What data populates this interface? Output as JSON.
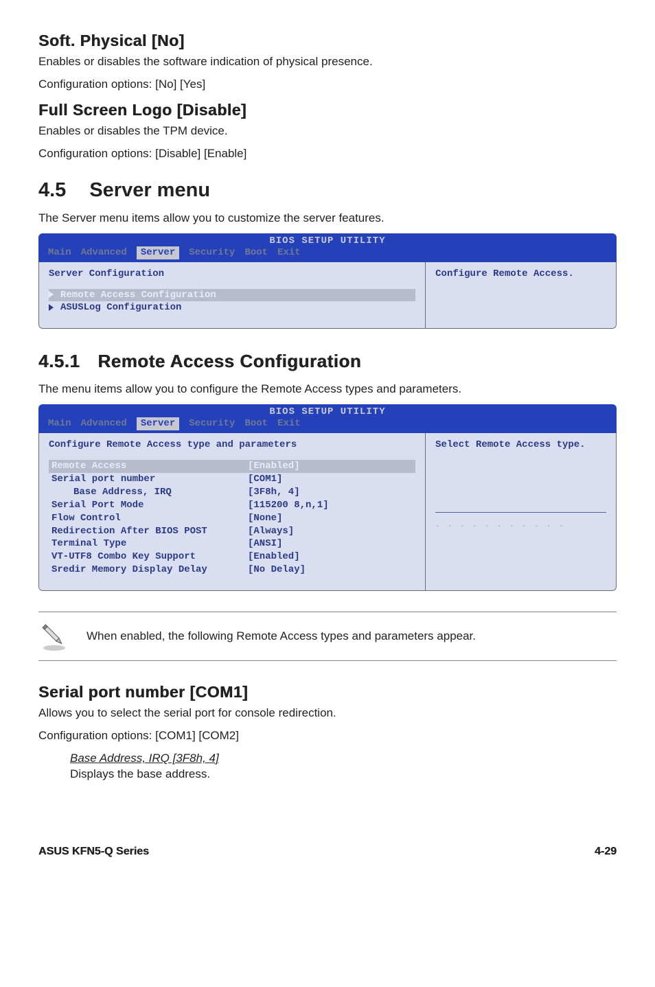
{
  "soft": {
    "heading": "Soft. Physical [No]",
    "line1": "Enables or disables the software indication of physical presence.",
    "line2": "Configuration options: [No] [Yes]"
  },
  "fsl": {
    "heading": "Full Screen Logo [Disable]",
    "line1": "Enables or disables the TPM device.",
    "line2": "Configuration options: [Disable] [Enable]"
  },
  "server_menu": {
    "num": "4.5",
    "title": "Server menu",
    "desc": "The Server menu items allow you to customize the server features."
  },
  "bios1": {
    "title": "BIOS SETUP UTILITY",
    "tabs": [
      "Main",
      "Advanced",
      "Server",
      "Security",
      "Boot",
      "Exit"
    ],
    "selected_tab": "Server",
    "section": "Server Configuration",
    "items": [
      "Remote Access Configuration",
      "ASUSLog Configuration"
    ],
    "help": "Configure Remote Access."
  },
  "remote": {
    "num": "4.5.1",
    "title": "Remote Access Configuration",
    "desc": "The menu items allow you to configure the Remote Access  types and parameters."
  },
  "bios2": {
    "title": "BIOS SETUP UTILITY",
    "tabs": [
      "Main",
      "Advanced",
      "Server",
      "Security",
      "Boot",
      "Exit"
    ],
    "selected_tab": "Server",
    "section": "Configure Remote Access type and parameters",
    "params": [
      {
        "name": "Remote Access",
        "value": "[Enabled]",
        "selected": true
      },
      {
        "name": "Serial port number",
        "value": "[COM1]"
      },
      {
        "name": "Base Address, IRQ",
        "value": "[3F8h, 4]",
        "indent": true
      },
      {
        "name": "Serial Port Mode",
        "value": "[115200 8,n,1]"
      },
      {
        "name": "Flow Control",
        "value": "[None]"
      },
      {
        "name": "Redirection After BIOS POST",
        "value": "[Always]"
      },
      {
        "name": "Terminal Type",
        "value": "[ANSI]"
      },
      {
        "name": "VT-UTF8 Combo Key Support",
        "value": "[Enabled]"
      },
      {
        "name": "Sredir Memory Display Delay",
        "value": "[No Delay]"
      }
    ],
    "help": "Select Remote Access type."
  },
  "note": "When enabled, the following Remote Access types and parameters appear.",
  "serial": {
    "heading": "Serial port number [COM1]",
    "line1": "Allows you to select the serial port for console redirection.",
    "line2": "Configuration options: [COM1] [COM2]",
    "sub_heading": "Base Address, IRQ [3F8h, 4]",
    "sub_text": "Displays the base address."
  },
  "footer": {
    "left": "ASUS KFN5-Q Series",
    "right": "4-29"
  }
}
